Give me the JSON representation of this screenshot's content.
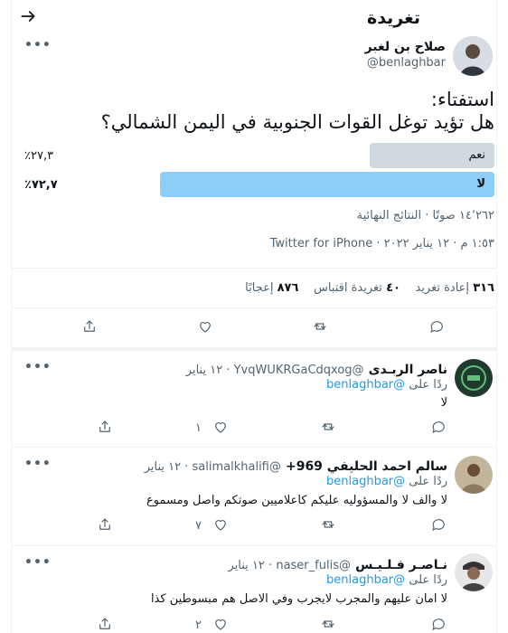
{
  "header": {
    "title": "تغريدة"
  },
  "tweet": {
    "author_name": "صلاح بن لغبر",
    "handle": "@benlaghbar",
    "text_line1": "استفتاء:",
    "text_line2": "هل تؤيد توغل القوات الجنوبية في اليمن الشمالي؟",
    "poll": {
      "options": [
        {
          "label": "نعم",
          "percent_text": "٢٧,٣٪",
          "percent": 27.3,
          "color": "#cfd9de"
        },
        {
          "label": "لا",
          "percent_text": "٧٢,٧٪",
          "percent": 72.7,
          "color": "#8ecdf8"
        }
      ],
      "votes_summary": "١٤٬٢٦٢ صوتًا · النتائج النهائية"
    },
    "meta": "١:٥٣ م · ١٢ يناير ٢٠٢٢ · Twitter for iPhone",
    "stats": {
      "retweets_num": "٣١٦",
      "retweets_label": "إعادة تغريد",
      "quotes_num": "٤٠",
      "quotes_label": "تغريدة اقتباس",
      "likes_num": "٨٧٦",
      "likes_label": "إعجابًا"
    }
  },
  "replies": [
    {
      "name": "ناصر الربـدى",
      "handle_time": "@YvqWUKRGaCdqxog · ١٢ يناير",
      "replying_prefix": "ردًا على",
      "replying_to": "@benlaghbar",
      "text": "لا",
      "like_count": "١"
    },
    {
      "name": "سالم احمد الحليفي 969+",
      "handle_time": "@salimalkhalifi · ١٢ يناير",
      "replying_prefix": "ردًا على",
      "replying_to": "@benlaghbar",
      "text": "لا والف لا والمسؤوليه عليكم كاعلاميين صوتكم واصل ومسموع",
      "like_count": "٧"
    },
    {
      "name": "نـاصـر فـلـيـس",
      "handle_time": "@naser_fulis · ١٢ يناير",
      "replying_prefix": "ردًا على",
      "replying_to": "@benlaghbar",
      "text": "لا امان عليهم والمجرب لايجرب وفي الاصل هم مبسوطين كذا",
      "like_count": "٢"
    }
  ]
}
